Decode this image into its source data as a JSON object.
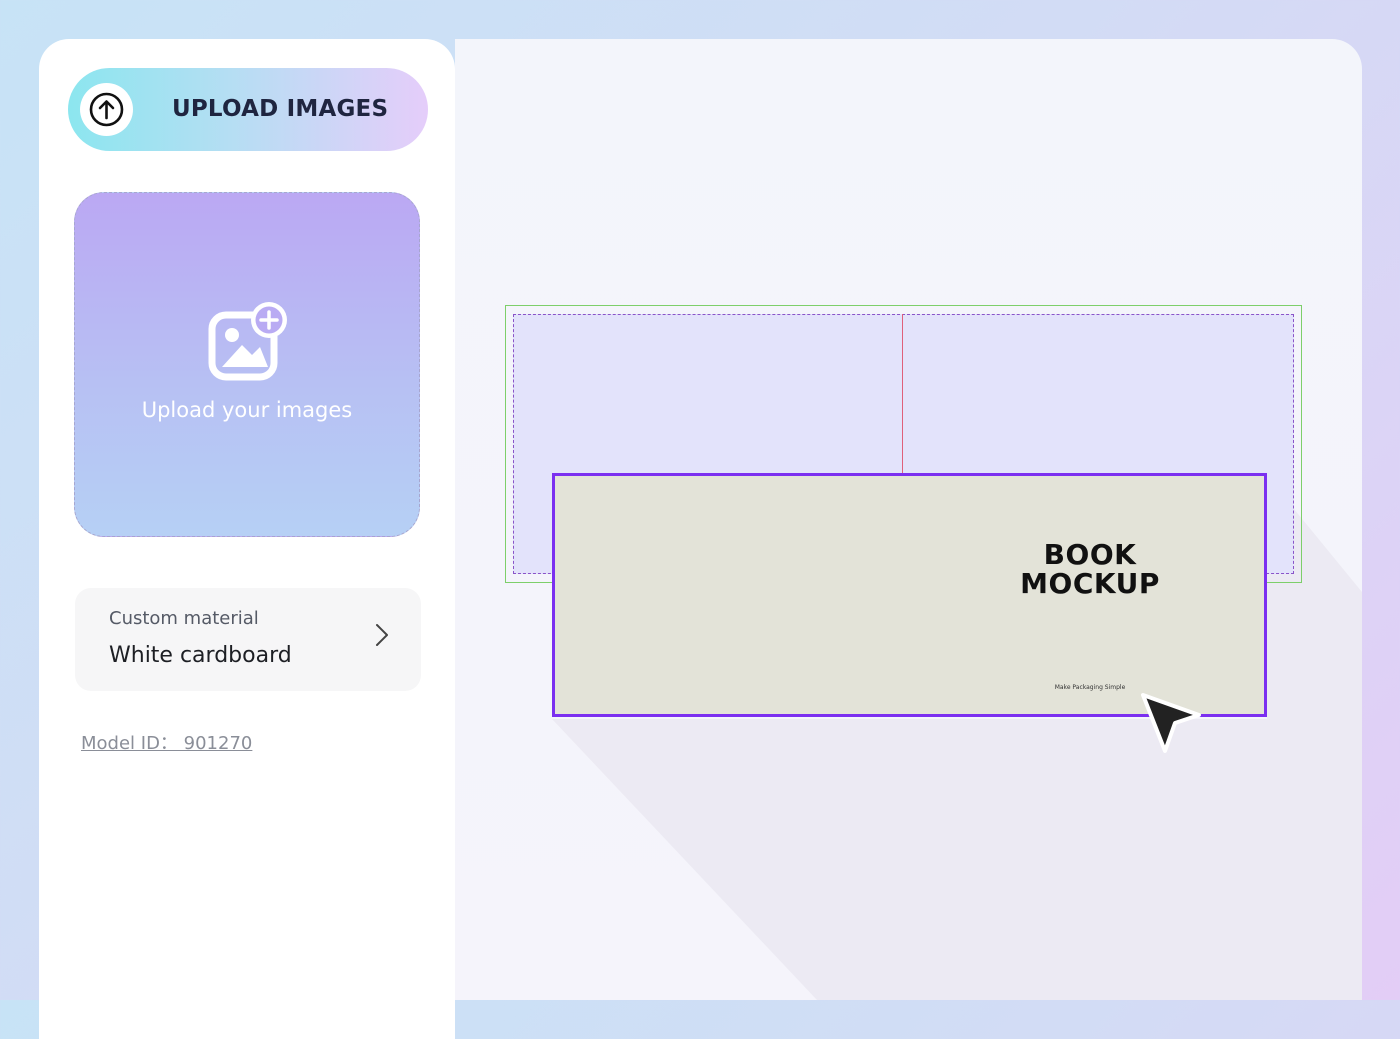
{
  "sidebar": {
    "upload_button_label": "UPLOAD IMAGES",
    "dropzone_label": "Upload your images",
    "material": {
      "title": "Custom material",
      "value": "White cardboard"
    },
    "model_id": "Model ID： 901270"
  },
  "canvas": {
    "book_title_line1": "BOOK",
    "book_title_line2": "MOCKUP",
    "tagline": "Make Packaging Simple"
  },
  "icons": {
    "upload": "arrow-up-circle-icon",
    "add_image": "image-plus-icon",
    "chevron": "chevron-right-icon",
    "cursor": "mouse-pointer-icon"
  },
  "colors": {
    "selection_border": "#7b2ff0",
    "bleed_line": "#7dcf6a",
    "fold_line": "#e0607a",
    "cover": "#e3e3d8"
  }
}
